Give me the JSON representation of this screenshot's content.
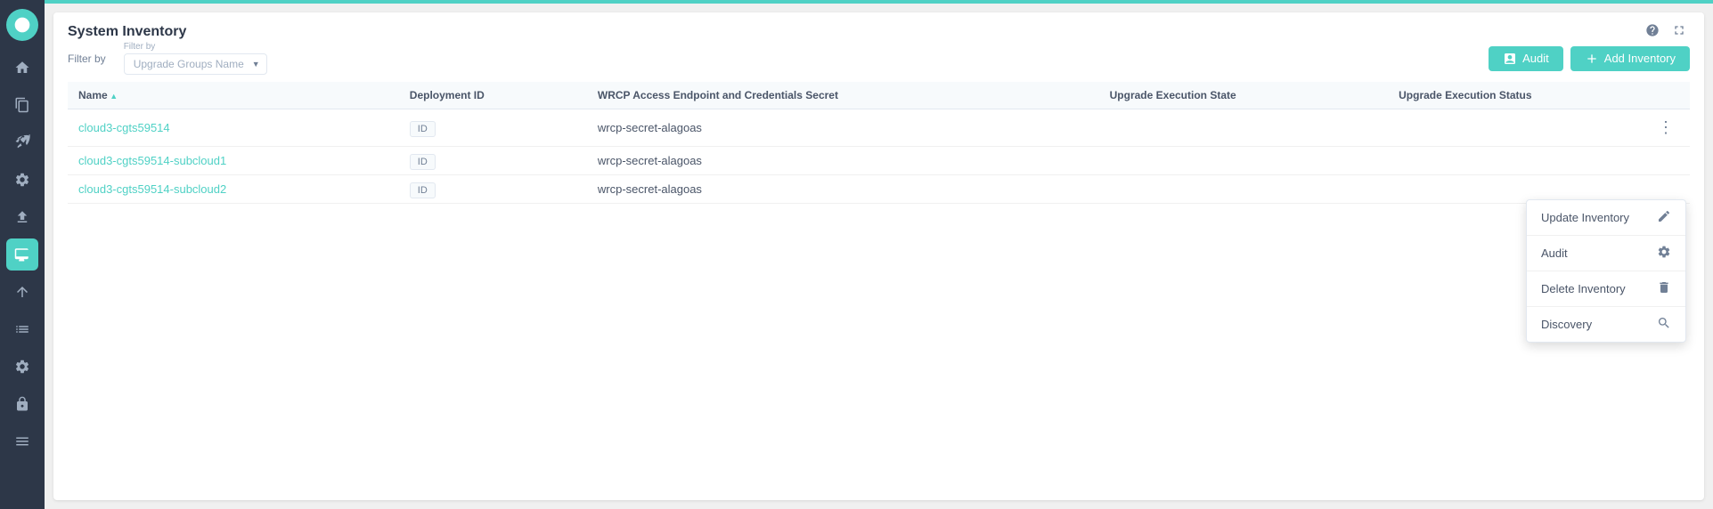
{
  "sidebar": {
    "items": [
      {
        "label": "Home",
        "icon": "home",
        "active": false
      },
      {
        "label": "Copy",
        "icon": "copy",
        "active": false
      },
      {
        "label": "Rocket",
        "icon": "rocket",
        "active": false
      },
      {
        "label": "Settings",
        "icon": "settings",
        "active": false
      },
      {
        "label": "Upload",
        "icon": "upload",
        "active": false
      },
      {
        "label": "System Inventory",
        "icon": "monitor",
        "active": true
      },
      {
        "label": "Arrow Up",
        "icon": "arrow-up",
        "active": false
      },
      {
        "label": "List",
        "icon": "list",
        "active": false
      },
      {
        "label": "Gear",
        "icon": "gear",
        "active": false
      },
      {
        "label": "Lock",
        "icon": "lock",
        "active": false
      },
      {
        "label": "Menu",
        "icon": "menu",
        "active": false
      }
    ]
  },
  "page": {
    "title": "System Inventory",
    "filter_label": "Filter by",
    "filter_placeholder": "Upgrade Groups Name"
  },
  "toolbar": {
    "audit_label": "Audit",
    "add_inventory_label": "Add Inventory"
  },
  "table": {
    "columns": [
      {
        "label": "Name",
        "sortable": true
      },
      {
        "label": "Deployment ID",
        "sortable": false
      },
      {
        "label": "WRCP Access Endpoint and Credentials Secret",
        "sortable": false
      },
      {
        "label": "Upgrade Execution State",
        "sortable": false
      },
      {
        "label": "Upgrade Execution Status",
        "sortable": false
      }
    ],
    "rows": [
      {
        "name": "cloud3-cgts59514",
        "deployment_id": "ID",
        "secret": "wrcp-secret-alagoas",
        "execution_state": "",
        "execution_status": ""
      },
      {
        "name": "cloud3-cgts59514-subcloud1",
        "deployment_id": "ID",
        "secret": "wrcp-secret-alagoas",
        "execution_state": "",
        "execution_status": ""
      },
      {
        "name": "cloud3-cgts59514-subcloud2",
        "deployment_id": "ID",
        "secret": "wrcp-secret-alagoas",
        "execution_state": "",
        "execution_status": ""
      }
    ]
  },
  "context_menu": {
    "items": [
      {
        "label": "Update Inventory",
        "icon": "edit"
      },
      {
        "label": "Audit",
        "icon": "settings"
      },
      {
        "label": "Delete Inventory",
        "icon": "trash"
      },
      {
        "label": "Discovery",
        "icon": "search"
      }
    ]
  },
  "colors": {
    "accent": "#4fd1c5",
    "sidebar_bg": "#2d3748",
    "text_primary": "#4a5568",
    "text_muted": "#718096"
  }
}
